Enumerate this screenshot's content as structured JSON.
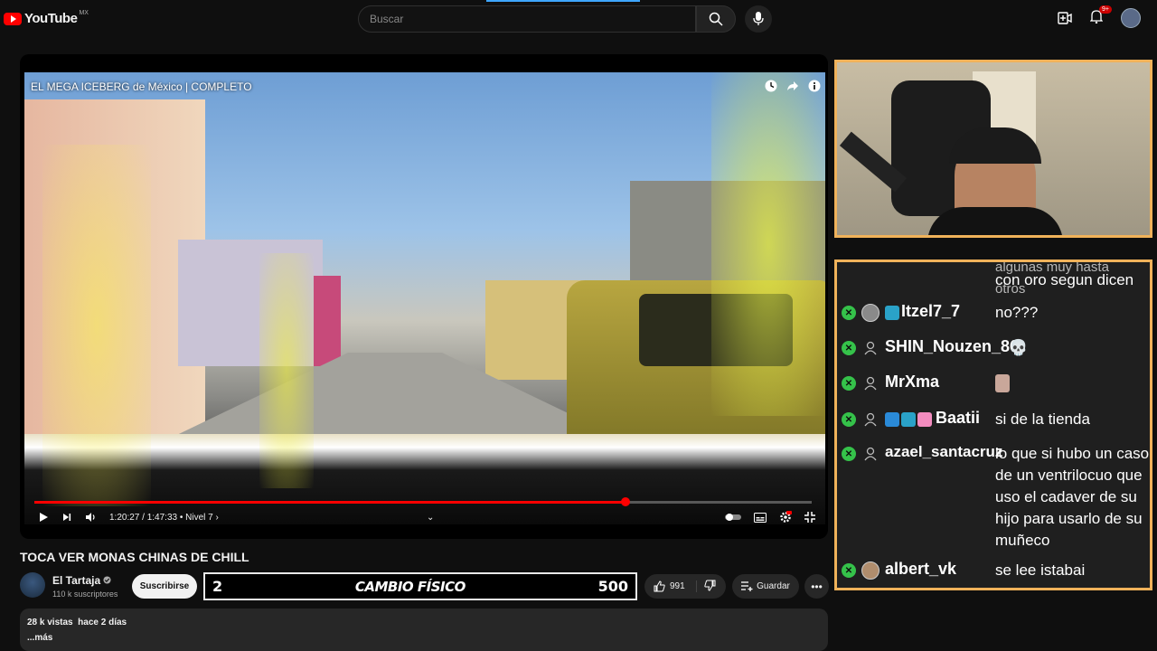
{
  "header": {
    "logo_text": "YouTube",
    "region": "MX",
    "search_placeholder": "Buscar",
    "notifications_badge": "9+"
  },
  "player": {
    "video_title": "EL MEGA ICEBERG de México | COMPLETO",
    "current_time": "1:20:27",
    "duration": "1:47:33",
    "chapter": "Nivel 7",
    "progress_fraction": 0.76
  },
  "chat": {
    "partial_message_top": "algunas muy hasta otros",
    "partial_message": "con oro segun dicen",
    "messages": [
      {
        "user": "Itzel7_7",
        "text": "no???"
      },
      {
        "user": "SHIN_Nouzen_86",
        "text": "💀"
      },
      {
        "user": "MrXma",
        "text": ""
      },
      {
        "user": "Baatii",
        "text": "si de la tienda"
      },
      {
        "user": "azael_santacruz",
        "text": "lo que si hubo un caso de un ventrilocuo que uso el cadaver de su hijo para usarlo de su muñeco"
      },
      {
        "user": "albert_vk",
        "text": "se lee istabai"
      }
    ]
  },
  "video_info": {
    "title": "TOCA VER MONAS CHINAS DE CHILL",
    "channel_name": "El Tartaja",
    "subscribers": "110 k suscriptores",
    "subscribe_label": "Suscribirse",
    "likes": "991",
    "save_label": "Guardar",
    "views": "28 k vistas",
    "uploaded": "hace 2 días",
    "more_label": "...más"
  },
  "stream_overlay": {
    "left_num": "2",
    "label": "CAMBIO FÍSICO",
    "right_num": "500"
  },
  "colors": {
    "accent_red": "#ff0000",
    "frame_orange": "#f0b25a",
    "mod_green": "#35c24a"
  }
}
